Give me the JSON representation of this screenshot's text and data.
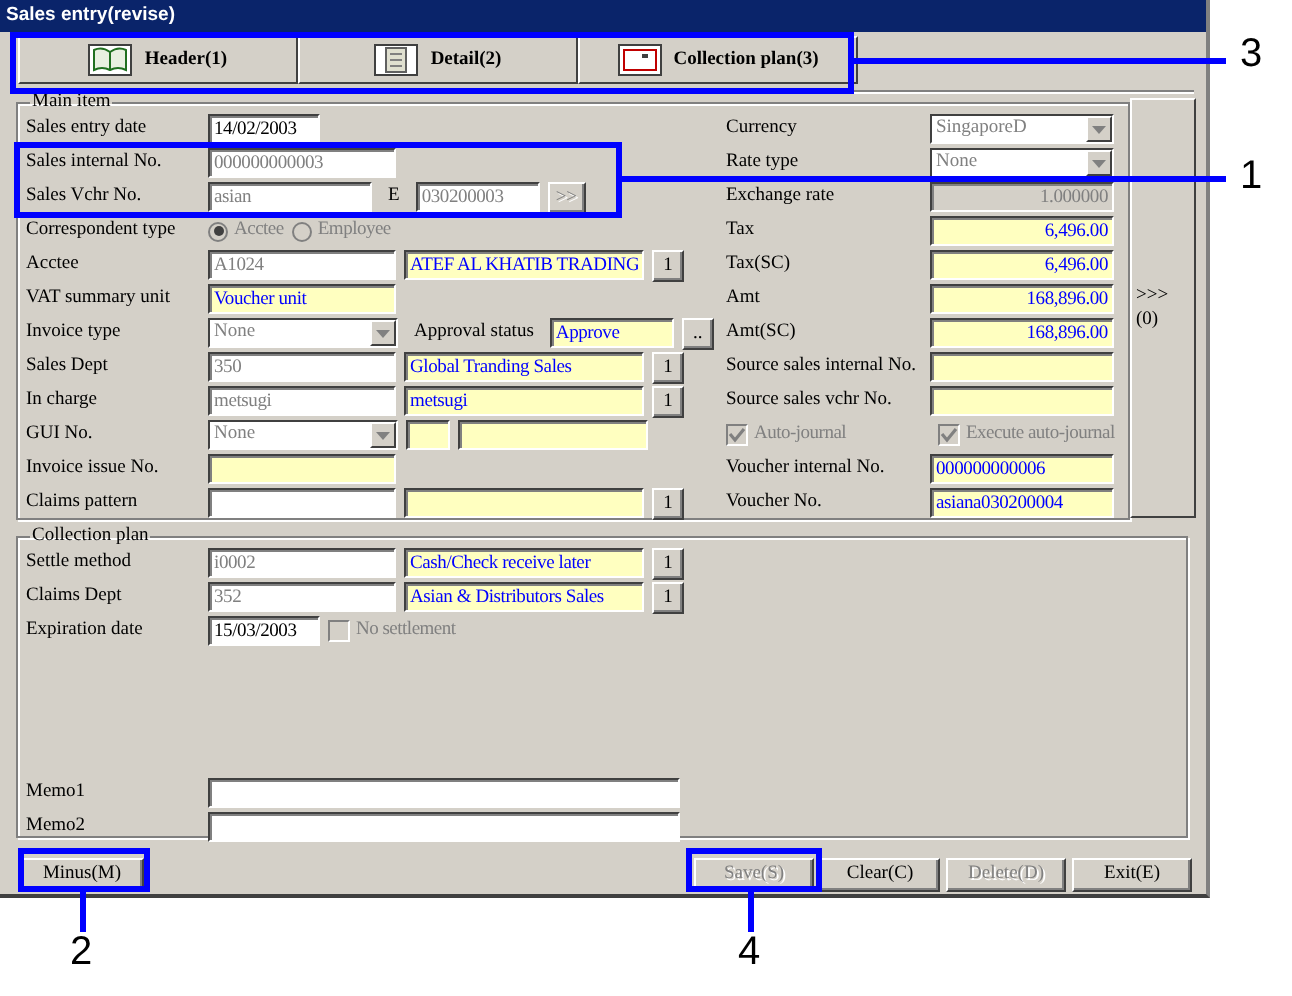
{
  "window": {
    "title": "Sales entry(revise)"
  },
  "tabs": [
    {
      "label": "Header(1)"
    },
    {
      "label": "Detail(2)"
    },
    {
      "label": "Collection plan(3)"
    }
  ],
  "main_item": {
    "title": "Main item",
    "left_rows": [
      {
        "label": "Sales entry date",
        "items": [
          {
            "kind": "date",
            "value": "14/02/2003",
            "disabled": false,
            "readonly": false
          }
        ]
      },
      {
        "label": "Sales internal No.",
        "items": [
          {
            "kind": "code",
            "value": "000000000003",
            "disabled": true,
            "readonly": false
          }
        ]
      },
      {
        "label": "Sales Vchr No.",
        "items": [
          {
            "kind": "prefix",
            "value": "asian",
            "disabled": true,
            "readonly": false
          },
          {
            "kind": "label",
            "text": "E"
          },
          {
            "kind": "serial",
            "value": "030200003",
            "disabled": true,
            "readonly": false
          },
          {
            "kind": "button",
            "label": ">>",
            "disabled": true
          }
        ]
      },
      {
        "label": "Correspondent type",
        "items": [
          {
            "kind": "radio",
            "label": "Acctee",
            "selected": true,
            "disabled": true
          },
          {
            "kind": "radio",
            "label": "Employee",
            "selected": false,
            "disabled": true
          }
        ]
      },
      {
        "label": "Acctee",
        "items": [
          {
            "kind": "code",
            "value": "A1024",
            "disabled": true,
            "readonly": false
          },
          {
            "kind": "name",
            "value": "ATEF AL KHATIB TRADING",
            "disabled": false,
            "readonly": true
          },
          {
            "kind": "button",
            "label": "1",
            "disabled": false
          }
        ]
      },
      {
        "label": "VAT summary unit",
        "items": [
          {
            "kind": "code",
            "value": "Voucher unit",
            "disabled": false,
            "readonly": true
          }
        ]
      },
      {
        "label": "Invoice type",
        "items": [
          {
            "kind": "combo",
            "value": "None",
            "disabled": true
          },
          {
            "kind": "label",
            "text": "Approval status"
          },
          {
            "kind": "status",
            "value": "Approve",
            "disabled": false,
            "readonly": true
          },
          {
            "kind": "button",
            "label": "..",
            "disabled": false
          }
        ]
      },
      {
        "label": "Sales Dept",
        "items": [
          {
            "kind": "code",
            "value": "350",
            "disabled": true,
            "readonly": false
          },
          {
            "kind": "name",
            "value": "Global Tranding Sales",
            "disabled": false,
            "readonly": true
          },
          {
            "kind": "button",
            "label": "1",
            "disabled": false
          }
        ]
      },
      {
        "label": "In charge",
        "items": [
          {
            "kind": "code",
            "value": "metsugi",
            "disabled": true,
            "readonly": false
          },
          {
            "kind": "name",
            "value": "metsugi",
            "disabled": false,
            "readonly": true
          },
          {
            "kind": "button",
            "label": "1",
            "disabled": false
          }
        ]
      },
      {
        "label": "GUI No.",
        "items": [
          {
            "kind": "combo",
            "value": "None",
            "disabled": true
          },
          {
            "kind": "segment",
            "disabled": false,
            "readonly": true
          },
          {
            "kind": "rest",
            "disabled": false,
            "readonly": true
          }
        ]
      },
      {
        "label": "Invoice issue No.",
        "items": [
          {
            "kind": "code",
            "disabled": false,
            "readonly": true
          }
        ]
      },
      {
        "label": "Claims pattern",
        "items": [
          {
            "kind": "code",
            "readonly": false
          },
          {
            "kind": "name",
            "disabled": false,
            "readonly": true
          },
          {
            "kind": "button",
            "label": "1",
            "disabled": false
          }
        ]
      }
    ],
    "right_rows": [
      {
        "label": "Currency",
        "items": [
          {
            "kind": "combo",
            "value": "SingaporeD",
            "disabled": true
          }
        ]
      },
      {
        "label": "Rate type",
        "items": [
          {
            "kind": "combo",
            "value": "None",
            "disabled": true
          }
        ]
      },
      {
        "label": "Exchange rate",
        "items": [
          {
            "kind": "amount",
            "value": "1.000000",
            "disabled": true,
            "readonly": true
          }
        ]
      },
      {
        "label": "Tax",
        "items": [
          {
            "kind": "amount",
            "value": "6,496.00",
            "disabled": false,
            "readonly": true
          }
        ]
      },
      {
        "label": "Tax(SC)",
        "items": [
          {
            "kind": "amount",
            "value": "6,496.00",
            "disabled": false,
            "readonly": true
          }
        ]
      },
      {
        "label": "Amt",
        "items": [
          {
            "kind": "amount",
            "value": "168,896.00",
            "disabled": false,
            "readonly": true
          }
        ]
      },
      {
        "label": "Amt(SC)",
        "items": [
          {
            "kind": "amount",
            "value": "168,896.00",
            "disabled": false,
            "readonly": true
          }
        ]
      },
      {
        "label": "Source sales internal No.",
        "items": [
          {
            "kind": "code",
            "disabled": false,
            "readonly": true
          }
        ]
      },
      {
        "label": "Source sales vchr No.",
        "items": [
          {
            "kind": "code",
            "disabled": false,
            "readonly": true
          }
        ]
      },
      {
        "items": [
          {
            "kind": "checkbox",
            "label": "Auto-journal",
            "checked": true,
            "disabled": true
          },
          {
            "kind": "checkbox",
            "label": "Execute auto-journal",
            "checked": true,
            "disabled": true
          }
        ]
      },
      {
        "label": "Voucher internal No.",
        "items": [
          {
            "kind": "code",
            "value": "000000000006",
            "disabled": false,
            "readonly": true
          }
        ]
      },
      {
        "label": "Voucher No.",
        "items": [
          {
            "kind": "code",
            "value": "asiana030200004",
            "disabled": false,
            "readonly": true
          }
        ]
      }
    ]
  },
  "side_button": {
    "label": ">>>(0)"
  },
  "collection_plan": {
    "title": "Collection plan",
    "rows": [
      {
        "label": "Settle method",
        "items": [
          {
            "kind": "code",
            "value": "i0002",
            "disabled": true,
            "readonly": false
          },
          {
            "kind": "name",
            "value": "Cash/Check receive later",
            "disabled": false,
            "readonly": true
          },
          {
            "kind": "button",
            "label": "1",
            "disabled": false
          }
        ]
      },
      {
        "label": "Claims Dept",
        "items": [
          {
            "kind": "code",
            "value": "352",
            "disabled": true,
            "readonly": false
          },
          {
            "kind": "name",
            "value": "Asian & Distributors Sales",
            "disabled": false,
            "readonly": true
          },
          {
            "kind": "button",
            "label": "1",
            "disabled": false
          }
        ]
      },
      {
        "label": "Expiration date",
        "items": [
          {
            "kind": "date",
            "value": "15/03/2003",
            "disabled": false,
            "readonly": false
          },
          {
            "kind": "checkbox",
            "label": "No settlement",
            "checked": false,
            "disabled": true
          }
        ]
      }
    ],
    "memo_rows": [
      {
        "label": "Memo1",
        "items": [
          {
            "kind": "memo",
            "readonly": false
          }
        ]
      },
      {
        "label": "Memo2",
        "items": [
          {
            "kind": "memo",
            "readonly": false
          }
        ]
      }
    ]
  },
  "footer_buttons": [
    {
      "label": "Minus(M)",
      "disabled": false
    },
    {
      "label": "Save(S)",
      "disabled": true
    },
    {
      "label": "Clear(C)",
      "disabled": false
    },
    {
      "label": "Delete(D)",
      "disabled": true
    },
    {
      "label": "Exit(E)",
      "disabled": false
    }
  ],
  "callouts": [
    {
      "number": "3"
    },
    {
      "number": "1"
    },
    {
      "number": "2"
    },
    {
      "number": "4"
    }
  ]
}
